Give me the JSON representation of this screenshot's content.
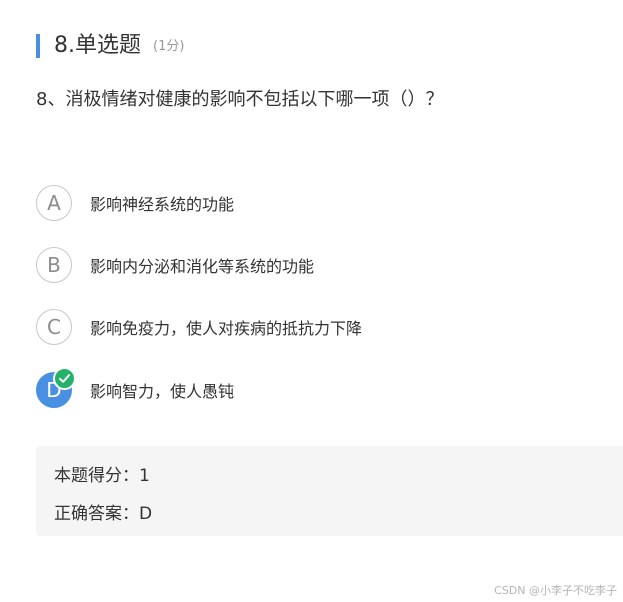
{
  "header": {
    "title": "8.单选题",
    "score": "(1分)"
  },
  "question": {
    "text": "8、消极情绪对健康的影响不包括以下哪一项（）？"
  },
  "options": [
    {
      "letter": "A",
      "text": "影响神经系统的功能"
    },
    {
      "letter": "B",
      "text": "影响内分泌和消化等系统的功能"
    },
    {
      "letter": "C",
      "text": "影响免疫力，使人对疾病的抵抗力下降"
    },
    {
      "letter": "D",
      "text": "影响智力，使人愚钝"
    }
  ],
  "selected_option": "D",
  "result": {
    "score_line": "本题得分：1",
    "answer_line": "正确答案：D"
  },
  "watermark": "CSDN @小李子不吃李子",
  "colors": {
    "accent": "#4a90e2",
    "correct": "#24b26b"
  }
}
